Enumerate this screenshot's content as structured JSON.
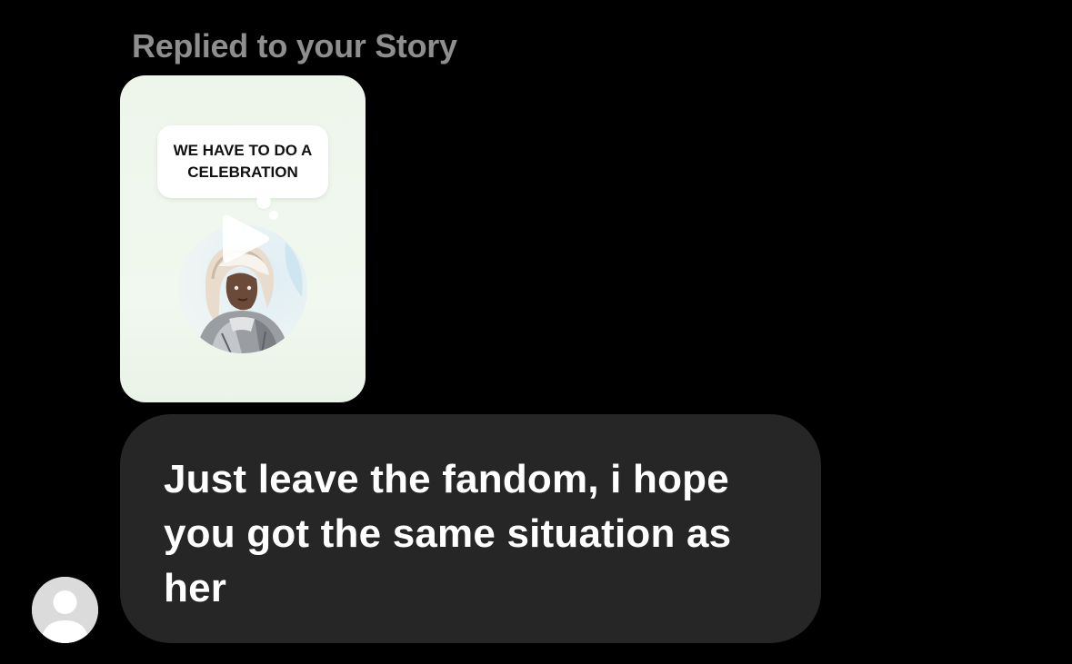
{
  "story_reply": {
    "label": "Replied to your Story",
    "thumbnail": {
      "caption": "WE HAVE TO DO A CELEBRATION",
      "icon": "play-icon",
      "background_color": "#eef6ec"
    }
  },
  "message": {
    "text": "Just leave the fandom, i hope you got the same situation as her",
    "bubble_color": "#262626",
    "text_color": "#ffffff"
  },
  "sender": {
    "avatar_icon": "default-profile-icon"
  },
  "colors": {
    "background": "#000000",
    "label": "#8e8e8e"
  }
}
